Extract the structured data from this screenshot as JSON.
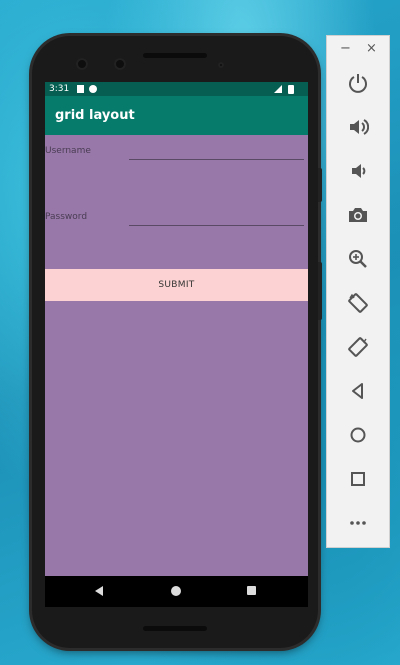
{
  "status_bar": {
    "time": "3:31"
  },
  "app_bar": {
    "title": "grid layout"
  },
  "form": {
    "username_label": "Username",
    "username_value": "",
    "password_label": "Password",
    "password_value": "",
    "submit_label": "SUBMIT"
  },
  "colors": {
    "status_bar": "#055e51",
    "app_bar": "#067b6b",
    "content_bg": "#9878a8",
    "submit_bg": "#fcd3d2"
  },
  "emulator_toolbar": {
    "window_controls": {
      "minimize": "−",
      "close": "×"
    },
    "buttons": [
      {
        "icon": "power-icon",
        "action": "power"
      },
      {
        "icon": "volume-up-icon",
        "action": "volume-up"
      },
      {
        "icon": "volume-down-icon",
        "action": "volume-down"
      },
      {
        "icon": "camera-icon",
        "action": "screenshot"
      },
      {
        "icon": "zoom-icon",
        "action": "zoom"
      },
      {
        "icon": "rotate-left-icon",
        "action": "rotate-left"
      },
      {
        "icon": "rotate-right-icon",
        "action": "rotate-right"
      },
      {
        "icon": "back-icon",
        "action": "back"
      },
      {
        "icon": "home-icon",
        "action": "home"
      },
      {
        "icon": "overview-icon",
        "action": "overview"
      },
      {
        "icon": "more-icon",
        "action": "more"
      }
    ]
  }
}
